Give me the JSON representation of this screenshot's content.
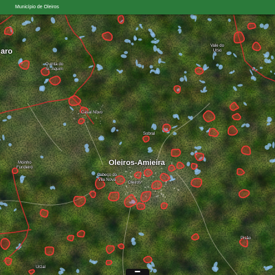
{
  "header": {
    "title": "Município de Oleiros"
  },
  "map": {
    "labels": {
      "partial_place": "aro",
      "quinta": {
        "line1": "Quinta do",
        "line2": "Sr. Aquim"
      },
      "vale": {
        "line1": "Vale do",
        "line2": "Urso"
      },
      "casal_novo": "Casal Novo",
      "sobral": "Sobral",
      "moinho": {
        "line1": "Moinho",
        "line2": "Fundeiro"
      },
      "parish": "Oleiros-Amieira",
      "cabeco": {
        "line1": "Cabeço do",
        "line2": "Vila Nova"
      },
      "town": "Oleiros",
      "pisao": "Pisão",
      "urzal": "Urzal"
    }
  },
  "controls": {
    "bottom_panel_toggle": {
      "icon": "panel-handle-icon"
    }
  },
  "colors": {
    "header_bg": "#2b7a3a",
    "boundary": "#d32f2f",
    "urban_area": "#ef3b36",
    "blue_patch": "#8fbde9",
    "label_text": "#ffffff",
    "toggle_bg": "#141414"
  }
}
